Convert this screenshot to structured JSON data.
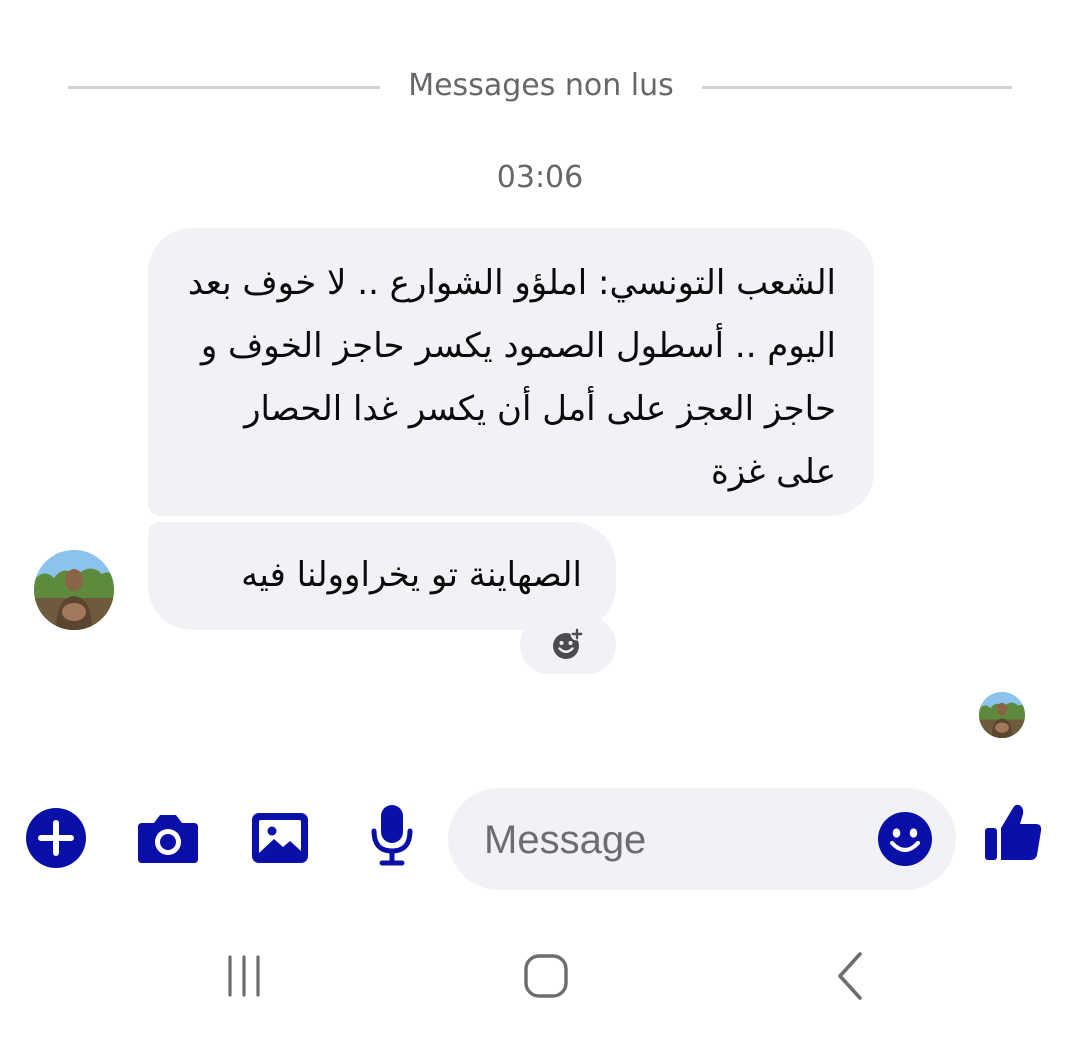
{
  "divider": {
    "label": "Messages non lus"
  },
  "thread": {
    "timestamp": "03:06",
    "messages": [
      {
        "text": "الشعب التونسي: املؤو الشوارع .. لا خوف بعد اليوم .. أسطول الصمود يكسر حاجز الخوف و حاجز العجز على أمل أن يكسر غدا الحصار على غزة"
      },
      {
        "text": "الصهاينة تو يخراوولنا فيه"
      }
    ]
  },
  "composer": {
    "placeholder": "Message",
    "icons": [
      "plus-icon",
      "camera-icon",
      "gallery-icon",
      "microphone-icon",
      "emoji-icon",
      "thumbs-up-icon"
    ]
  },
  "nav": {
    "icons": [
      "recents-icon",
      "home-icon",
      "back-icon"
    ]
  },
  "colors": {
    "accent": "#0a0fa8",
    "bubble": "#f1f2f5",
    "secondary_text": "#65676b",
    "divider": "#cfd3d8"
  }
}
